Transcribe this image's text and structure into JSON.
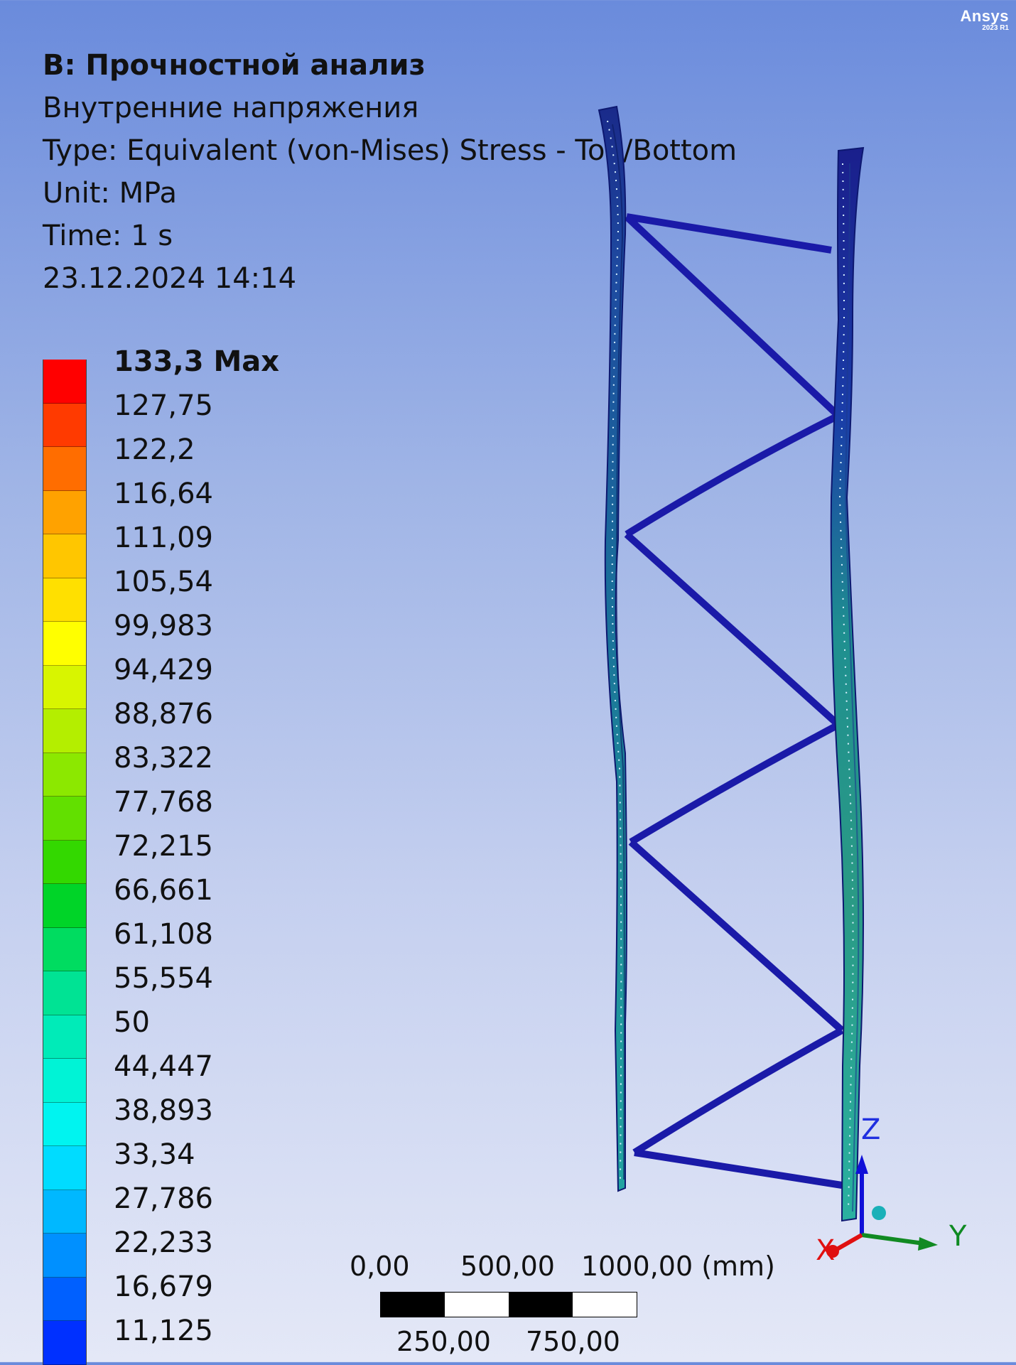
{
  "brand": {
    "name": "Ansys",
    "version": "2023 R1"
  },
  "info": {
    "title": "B: Прочностной анализ",
    "result_name": "Внутренние напряжения",
    "type": "Type: Equivalent (von-Mises) Stress - Top/Bottom",
    "unit": "Unit: MPa",
    "time": "Time: 1 s",
    "datetime": "23.12.2024 14:14"
  },
  "legend": {
    "max_label": "133,3 Max",
    "labels": [
      "127,75",
      "122,2",
      "116,64",
      "111,09",
      "105,54",
      "99,983",
      "94,429",
      "88,876",
      "83,322",
      "77,768",
      "72,215",
      "66,661",
      "61,108",
      "55,554",
      "50",
      "44,447",
      "38,893",
      "33,34",
      "27,786",
      "22,233",
      "16,679",
      "11,125"
    ],
    "colors": [
      "#ff0000",
      "#ff3a00",
      "#ff6d00",
      "#ffa200",
      "#ffc600",
      "#ffe000",
      "#ffff00",
      "#d8f500",
      "#b4ee00",
      "#8ce800",
      "#62e000",
      "#33d800",
      "#00d428",
      "#00dc60",
      "#00e394",
      "#00ebb8",
      "#00f3d6",
      "#00f4f0",
      "#00dcff",
      "#00b8ff",
      "#0090ff",
      "#0060ff",
      "#0030ff"
    ]
  },
  "scale": {
    "top_labels": [
      "0,00",
      "500,00",
      "1000,00 (mm)"
    ],
    "bottom_labels": [
      "250,00",
      "750,00"
    ]
  },
  "triad": {
    "x": "X",
    "y": "Y",
    "z": "Z"
  }
}
